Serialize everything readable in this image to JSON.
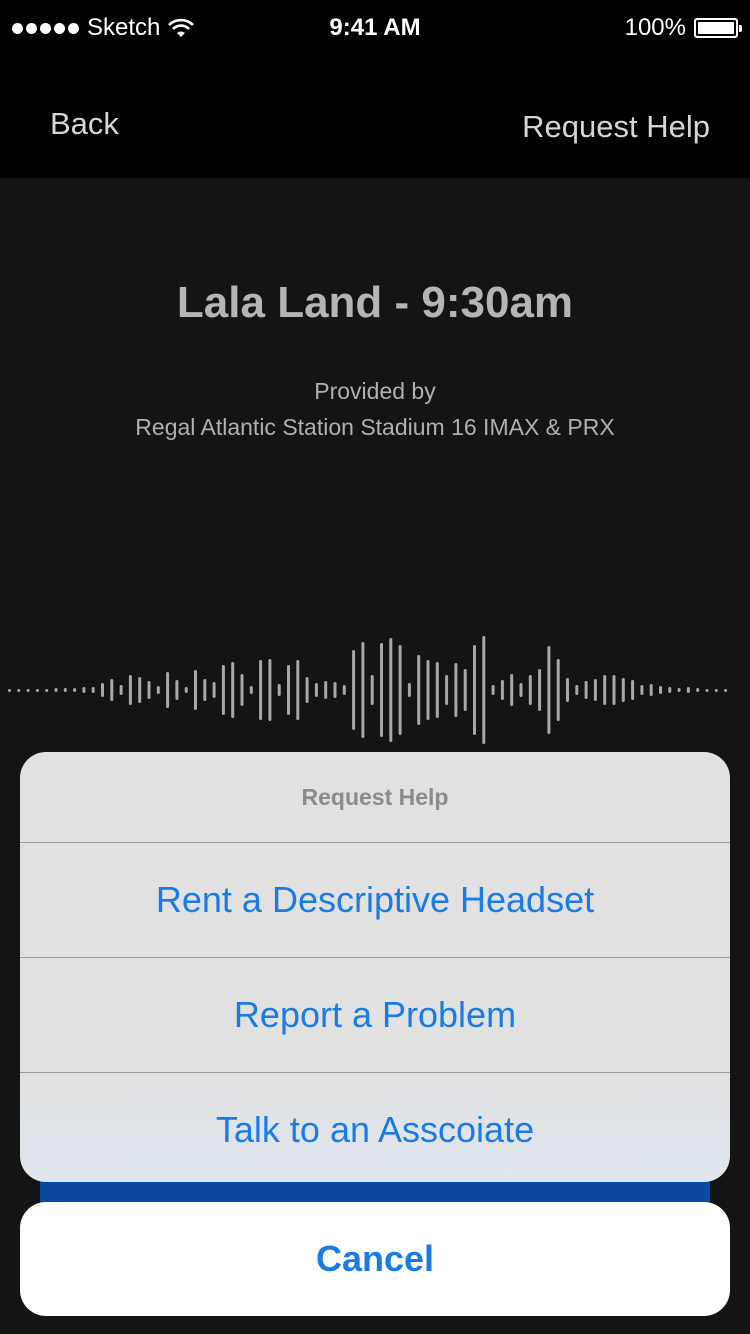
{
  "status_bar": {
    "carrier": "Sketch",
    "time": "9:41 AM",
    "battery_percent": "100%",
    "signal_dots": 5,
    "icons": [
      "signal-dots-icon",
      "wifi-icon",
      "battery-icon"
    ]
  },
  "nav": {
    "back_label": "Back",
    "action_label": "Request Help"
  },
  "movie": {
    "title": "Lala Land - 9:30am",
    "provided_label": "Provided by",
    "theater": "Regal Atlantic Station Stadium 16 IMAX & PRX"
  },
  "action_sheet": {
    "title": "Request Help",
    "items": [
      {
        "label": "Rent a Descriptive Headset"
      },
      {
        "label": "Report a Problem"
      },
      {
        "label": "Talk to an Asscoiate"
      }
    ],
    "cancel_label": "Cancel"
  },
  "colors": {
    "accent": "#1a7ae6",
    "background": "#141414",
    "nav_background": "#000000",
    "sheet_background": "#e1e1e1"
  }
}
